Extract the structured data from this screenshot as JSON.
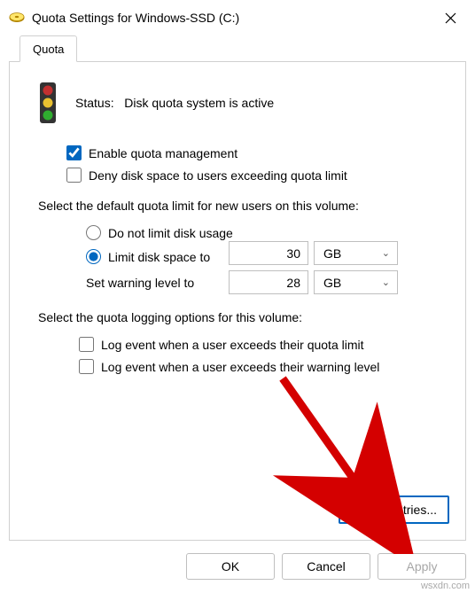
{
  "titlebar": {
    "title": "Quota Settings for Windows-SSD (C:)"
  },
  "tab": {
    "label": "Quota"
  },
  "status": {
    "label": "Status:",
    "value": "Disk quota system is active"
  },
  "options": {
    "enable_label": "Enable quota management",
    "deny_label": "Deny disk space to users exceeding quota limit"
  },
  "limit_section": {
    "heading": "Select the default quota limit for new users on this volume:",
    "no_limit_label": "Do not limit disk usage",
    "limit_label": "Limit disk space to",
    "warning_label": "Set warning level to",
    "limit_value": "30",
    "limit_unit": "GB",
    "warning_value": "28",
    "warning_unit": "GB"
  },
  "logging_section": {
    "heading": "Select the quota logging options for this volume:",
    "log_quota_label": "Log event when a user exceeds their quota limit",
    "log_warning_label": "Log event when a user exceeds their warning level"
  },
  "buttons": {
    "quota_entries": "Quota Entries...",
    "ok": "OK",
    "cancel": "Cancel",
    "apply": "Apply"
  },
  "watermark": "wsxdn.com"
}
